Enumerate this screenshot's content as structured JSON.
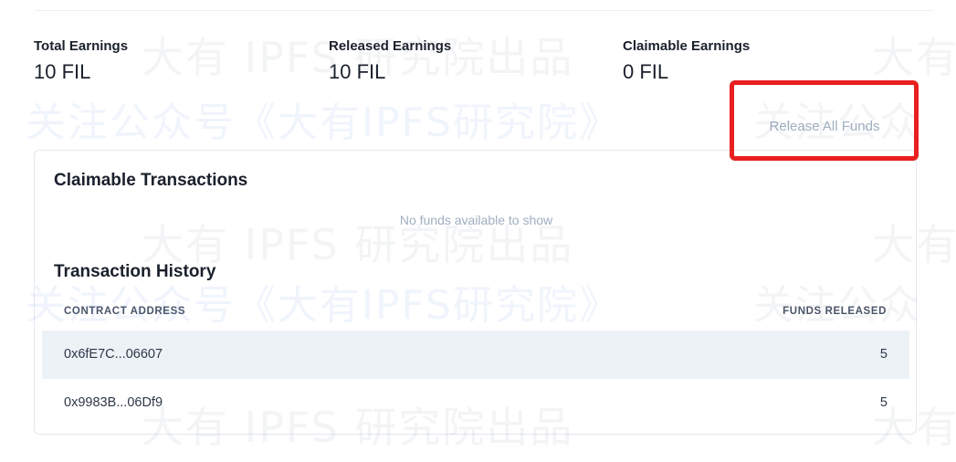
{
  "stats": {
    "total": {
      "label": "Total Earnings",
      "value": "10 FIL"
    },
    "released": {
      "label": "Released Earnings",
      "value": "10 FIL"
    },
    "claimable": {
      "label": "Claimable Earnings",
      "value": "0 FIL"
    }
  },
  "actions": {
    "release_all_label": "Release All Funds"
  },
  "claimable_transactions": {
    "title": "Claimable Transactions",
    "empty_message": "No funds available to show"
  },
  "transaction_history": {
    "title": "Transaction History",
    "columns": {
      "address": "CONTRACT ADDRESS",
      "released": "FUNDS RELEASED"
    },
    "rows": [
      {
        "address": "0x6fE7C...06607",
        "released": "5"
      },
      {
        "address": "0x9983B...06Df9",
        "released": "5"
      }
    ]
  },
  "watermark": {
    "name": "大有 IPFS 研究院出品",
    "follow": "关注公众号《大有IPFS研究院》",
    "follow_short": "关注公众",
    "name_short": "大有"
  },
  "colors": {
    "highlight": "#e8201f",
    "row_alt": "#edf2f7",
    "muted_text": "#a0aec0"
  }
}
